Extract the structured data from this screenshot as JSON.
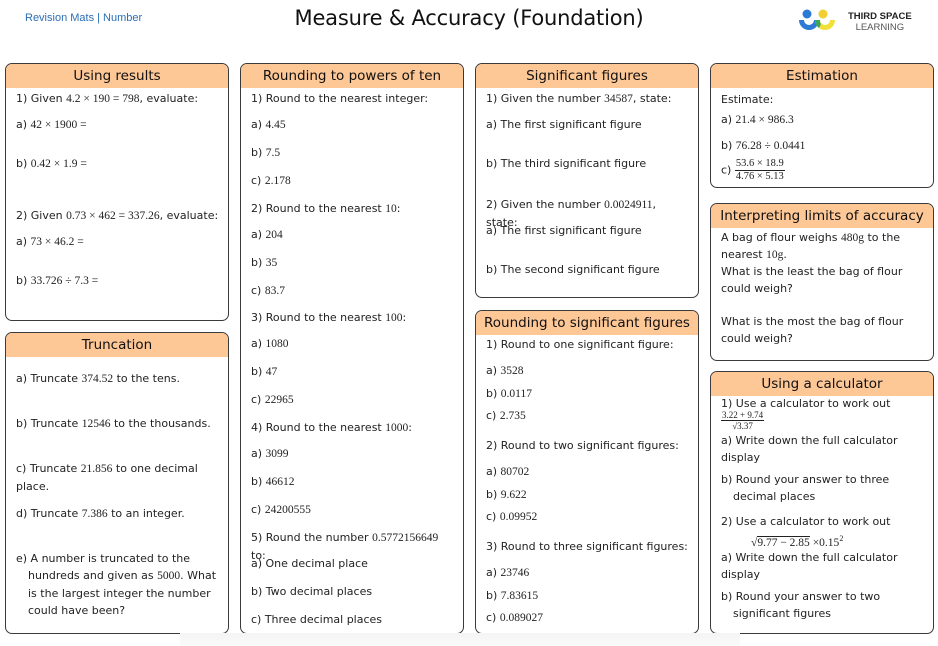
{
  "header": {
    "breadcrumb": "Revision Mats | Number",
    "title": "Measure & Accuracy (Foundation)",
    "logo": {
      "line1": "THIRD SPACE",
      "line2": "LEARNING",
      "icon": "third-space-learning-logo-icon"
    }
  },
  "colors": {
    "header_fill": "#fdc796",
    "border": "#3a3a3a",
    "link": "#2a6fb5"
  },
  "using_results": {
    "title": "Using results",
    "q1": {
      "pre": "1) Given ",
      "math": "4.2 × 190 = 798",
      "post": ", evaluate:"
    },
    "q1a": {
      "label": "a) ",
      "math": "42 × 1900 ="
    },
    "q1b": {
      "label": "b) ",
      "math": "0.42 × 1.9 ="
    },
    "q2": {
      "pre": "2) Given ",
      "math": "0.73 × 462 = 337.26",
      "post": ", evaluate:"
    },
    "q2a": {
      "label": "a) ",
      "math": "73 × 46.2 ="
    },
    "q2b": {
      "label": "b) ",
      "math": "33.726 ÷ 7.3 ="
    }
  },
  "truncation": {
    "title": "Truncation",
    "a": {
      "pre": "a) Truncate ",
      "math": "374.52",
      "post": " to the tens."
    },
    "b": {
      "pre": "b) Truncate ",
      "math": "12546",
      "post": " to the thousands."
    },
    "c": {
      "pre": "c) Truncate ",
      "math": "21.856",
      "post": " to one decimal place."
    },
    "d": {
      "pre": "d) Truncate ",
      "math": "7.386",
      "post": " to an integer."
    },
    "e": {
      "pre": "e) A number is truncated to the hundreds and given as ",
      "math": "5000",
      "post": ". What is the largest integer the number could have been?"
    }
  },
  "powers_of_ten": {
    "title": "Rounding to powers of ten",
    "q1": {
      "pre": "1) Round to the nearest integer:",
      "items": [
        [
          "a) ",
          "4.45"
        ],
        [
          "b) ",
          "7.5"
        ],
        [
          "c) ",
          "2.178"
        ]
      ]
    },
    "q2": {
      "pre": "2) Round to the nearest ",
      "math": "10",
      "post": ":",
      "items": [
        [
          "a) ",
          "204"
        ],
        [
          "b) ",
          "35"
        ],
        [
          "c) ",
          "83.7"
        ]
      ]
    },
    "q3": {
      "pre": "3) Round to the nearest ",
      "math": "100",
      "post": ":",
      "items": [
        [
          "a) ",
          "1080"
        ],
        [
          "b) ",
          "47"
        ],
        [
          "c) ",
          "22965"
        ]
      ]
    },
    "q4": {
      "pre": "4) Round to the nearest ",
      "math": "1000",
      "post": ":",
      "items": [
        [
          "a) ",
          "3099"
        ],
        [
          "b) ",
          "46612"
        ],
        [
          "c) ",
          "24200555"
        ]
      ]
    },
    "q5": {
      "pre": "5) Round the number ",
      "math": "0.5772156649",
      "post": " to:",
      "items": [
        "a) One decimal place",
        "b) Two decimal places",
        "c) Three decimal places"
      ]
    }
  },
  "sig_figs": {
    "title": "Significant figures",
    "q1": {
      "pre": "1) Given the number ",
      "math": "34587",
      "post": ", state:"
    },
    "q1a": "a) The first significant figure",
    "q1b": "b) The third significant figure",
    "q2": {
      "pre": "2) Given the number ",
      "math": "0.0024911",
      "post": ", state:"
    },
    "q2a": "a) The first significant figure",
    "q2b": "b) The second significant figure"
  },
  "rounding_sig_figs": {
    "title": "Rounding to significant figures",
    "q1": {
      "pre": "1) Round to one significant figure:",
      "items": [
        [
          "a) ",
          "3528"
        ],
        [
          "b) ",
          "0.0117"
        ],
        [
          "c) ",
          "2.735"
        ]
      ]
    },
    "q2": {
      "pre": "2) Round to two significant figures:",
      "items": [
        [
          "a) ",
          "80702"
        ],
        [
          "b) ",
          "9.622"
        ],
        [
          "c) ",
          "0.09952"
        ]
      ]
    },
    "q3": {
      "pre": "3) Round to three significant figures:",
      "items": [
        [
          "a) ",
          "23746"
        ],
        [
          "b) ",
          "7.83615"
        ],
        [
          "c) ",
          "0.089027"
        ]
      ]
    }
  },
  "estimation": {
    "title": "Estimation",
    "intro": "Estimate:",
    "a": {
      "label": "a) ",
      "math": "21.4 × 986.3"
    },
    "b": {
      "label": "b) ",
      "math": "76.28 ÷ 0.0441"
    },
    "c": {
      "label": "c) ",
      "numerator": "53.6 × 18.9",
      "denominator": "4.76 × 5.13"
    }
  },
  "limits": {
    "title": "Interpreting limits of accuracy",
    "line1_pre": "A bag of flour weighs ",
    "line1_math": "480g",
    "line1_post": " to the",
    "line2_pre": "nearest ",
    "line2_math": "10g",
    "line2_post": ".",
    "q_least": "What is the least the bag of flour could weigh?",
    "q_most": "What is the most the bag of flour could weigh?"
  },
  "calculator": {
    "title": "Using a calculator",
    "q1": {
      "pre": "1) Use a calculator to work out ",
      "numerator": "3.22 + 9.74",
      "denominator": "3.37"
    },
    "q1a": "a) Write down the full calculator display",
    "q1b": "b) Round your answer to three decimal places",
    "q2": {
      "pre": "2) Use a calculator to work out",
      "radicand": "9.77 − 2.85",
      "tail": "×0.15",
      "exp": "2"
    },
    "q2a": "a) Write down the full calculator display",
    "q2b": "b) Round your answer to two significant figures"
  }
}
